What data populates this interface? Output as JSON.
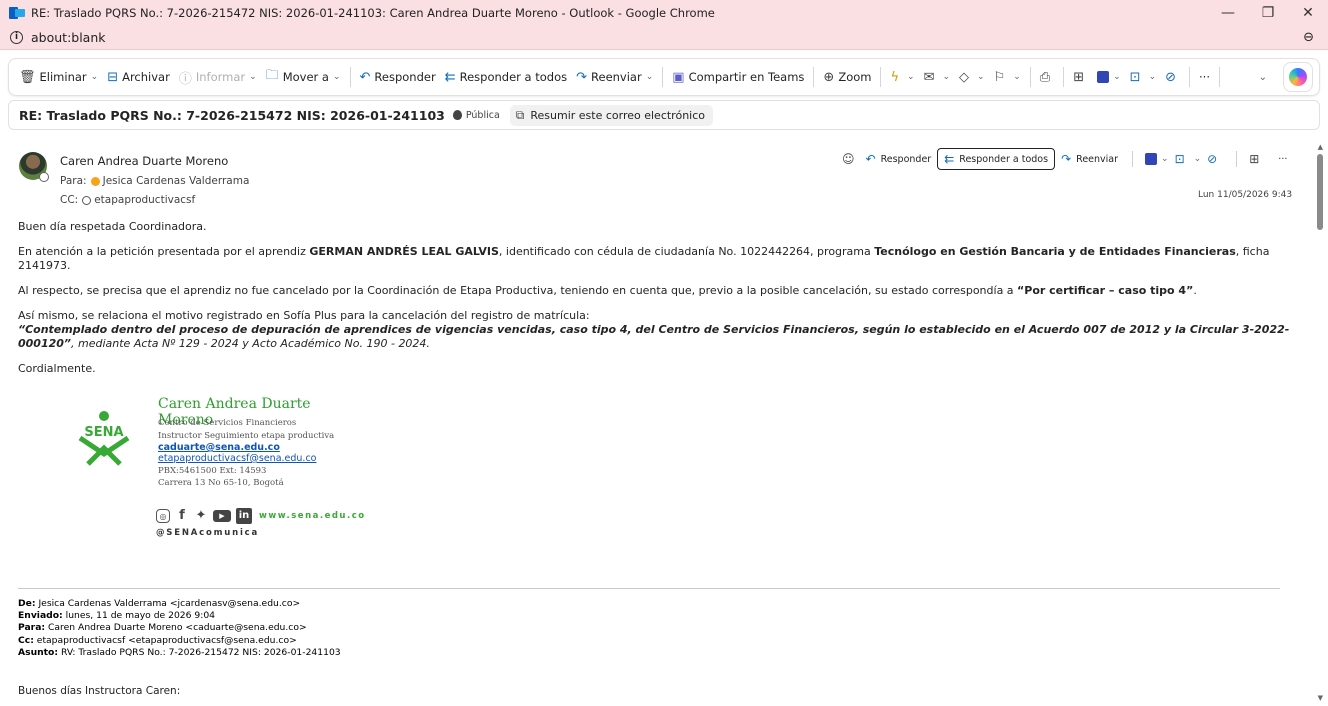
{
  "window": {
    "title": "RE: Traslado PQRS No.: 7-2026-215472 NIS: 2026-01-241103: Caren Andrea Duarte Moreno - Outlook - Google Chrome",
    "minimize": "—",
    "restore": "❐",
    "close": "✕"
  },
  "address": {
    "url": "about:blank"
  },
  "toolbar": {
    "delete": "Eliminar",
    "archive": "Archivar",
    "report": "Informar",
    "move": "Mover a",
    "reply": "Responder",
    "reply_all": "Responder a todos",
    "forward": "Reenviar",
    "teams": "Compartir en Teams",
    "zoom": "Zoom",
    "more": "···"
  },
  "subject": {
    "text": "RE: Traslado PQRS No.: 7-2026-215472 NIS: 2026-01-241103",
    "sensitivity": "Pública",
    "summarize": "Resumir este correo electrónico"
  },
  "message": {
    "sender": "Caren Andrea Duarte Moreno",
    "to_label": "Para:",
    "to": "Jesica Cardenas Valderrama",
    "cc_label": "CC:",
    "cc": "etapaproductivacsf",
    "date": "Lun 11/05/2026 9:43",
    "actions": {
      "reply": "Responder",
      "reply_all": "Responder a todos",
      "forward": "Reenviar"
    },
    "body": {
      "greeting": "Buen día respetada Coordinadora.",
      "p1_a": "En atención a la petición presentada por el aprendiz ",
      "p1_name": "GERMAN ANDRÉS LEAL GALVIS",
      "p1_b": ", identificado con cédula de ciudadanía No. 1022442264, programa ",
      "p1_program": "Tecnólogo en Gestión Bancaria y de Entidades Financieras",
      "p1_c": ", ficha 2141973.",
      "p2_a": "Al respecto, se precisa que el aprendiz no fue cancelado por la Coordinación de Etapa Productiva, teniendo en cuenta que, previo a la posible cancelación, su estado correspondía a ",
      "p2_status": "“Por certificar – caso tipo 4”",
      "p2_b": ".",
      "p3_a": "Así mismo, se relaciona el motivo registrado en Sofía Plus para la cancelación del registro de matrícula:",
      "p3_quote": "“Contemplado dentro del proceso de depuración de aprendices de vigencias vencidas, caso tipo 4, del Centro de Servicios Financieros, según lo establecido en el Acuerdo 007 de 2012 y la Circular 3-2022-000120”",
      "p3_rest": ", mediante Acta Nº 129 - 2024 y Acto Académico No. 190 - 2024.",
      "closing": "Cordialmente."
    },
    "signature": {
      "logo_text": "SENA",
      "name": "Caren Andrea Duarte Moreno",
      "line1": "Centro de Servicios Financieros",
      "line2": "Instructor Seguimiento etapa productiva",
      "email1": "caduarte@sena.edu.co",
      "email2": "etapaproductivacsf@sena.edu.co",
      "phone": "PBX:5461500 Ext: 14593",
      "address": "Carrera 13 No 65-10, Bogotá",
      "website": "www.sena.edu.co",
      "handle": "@SENAcomunica"
    },
    "forwarded": {
      "from_label": "De:",
      "from": "Jesica Cardenas Valderrama <jcardenasv@sena.edu.co>",
      "sent_label": "Enviado:",
      "sent": "lunes, 11 de mayo de 2026 9:04",
      "to_label": "Para:",
      "to": "Caren Andrea Duarte Moreno <caduarte@sena.edu.co>",
      "cc_label": "Cc:",
      "cc": "etapaproductivacsf <etapaproductivacsf@sena.edu.co>",
      "subject_label": "Asunto:",
      "subject": "RV: Traslado PQRS No.: 7-2026-215472 NIS: 2026-01-241103",
      "greeting": "Buenos días Instructora Caren:"
    }
  },
  "colors": {
    "titlebar": "#fbe0e3",
    "accent": "#0f6cbd",
    "sena_green": "#39a935"
  }
}
